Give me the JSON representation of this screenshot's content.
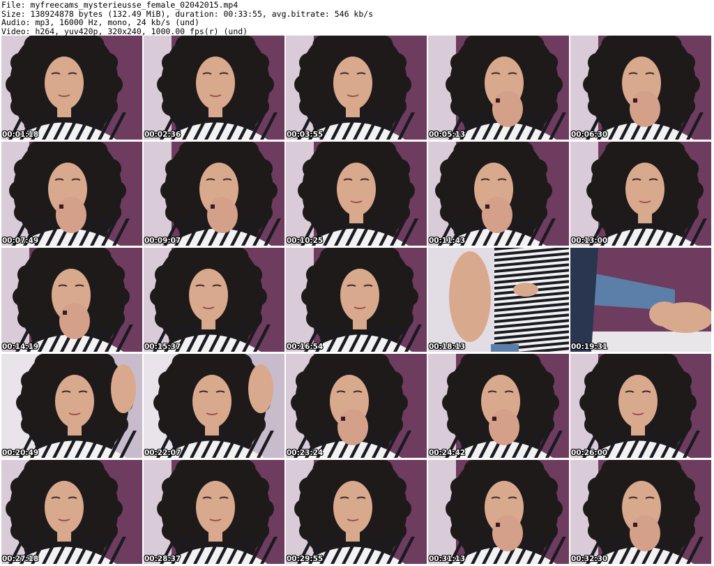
{
  "header": {
    "file": "File: myfreecams_mysterieusse_female_02042015.mp4",
    "size": "Size: 138924878 bytes (132.49 MiB), duration: 00:33:55, avg.bitrate: 546 kb/s",
    "audio": "Audio: mp3, 16000 Hz, mono, 24 kb/s (und)",
    "video": "Video: h264, yuv420p, 320x240, 1000.00 fps(r) (und)"
  },
  "thumbnails": [
    {
      "time": "00:01:18",
      "scene": "face"
    },
    {
      "time": "00:02:36",
      "scene": "face"
    },
    {
      "time": "00:03:55",
      "scene": "face"
    },
    {
      "time": "00:05:13",
      "scene": "hands"
    },
    {
      "time": "00:06:30",
      "scene": "hands"
    },
    {
      "time": "00:07:49",
      "scene": "hands"
    },
    {
      "time": "00:09:07",
      "scene": "hands"
    },
    {
      "time": "00:10:25",
      "scene": "face"
    },
    {
      "time": "00:11:43",
      "scene": "hands"
    },
    {
      "time": "00:13:00",
      "scene": "face"
    },
    {
      "time": "00:14:19",
      "scene": "hands"
    },
    {
      "time": "00:15:37",
      "scene": "face"
    },
    {
      "time": "00:16:54",
      "scene": "face"
    },
    {
      "time": "00:18:13",
      "scene": "torso"
    },
    {
      "time": "00:19:31",
      "scene": "feet"
    },
    {
      "time": "00:20:49",
      "scene": "room"
    },
    {
      "time": "00:22:07",
      "scene": "room"
    },
    {
      "time": "00:23:24",
      "scene": "hands"
    },
    {
      "time": "00:24:42",
      "scene": "hands"
    },
    {
      "time": "00:26:00",
      "scene": "face"
    },
    {
      "time": "00:27:18",
      "scene": "face"
    },
    {
      "time": "00:28:37",
      "scene": "face"
    },
    {
      "time": "00:29:55",
      "scene": "face"
    },
    {
      "time": "00:31:13",
      "scene": "hands"
    },
    {
      "time": "00:32:30",
      "scene": "hands"
    }
  ],
  "colors": {
    "wall_purple": "#6e3c5e",
    "wall_light": "#d8d0dc",
    "hair": "#1e1a1a",
    "skin": "#d9a98e",
    "stripe_dark": "#1a1a22",
    "stripe_light": "#f2f2f2",
    "denim": "#5b7fa8",
    "timestamp": "#ffffff"
  }
}
